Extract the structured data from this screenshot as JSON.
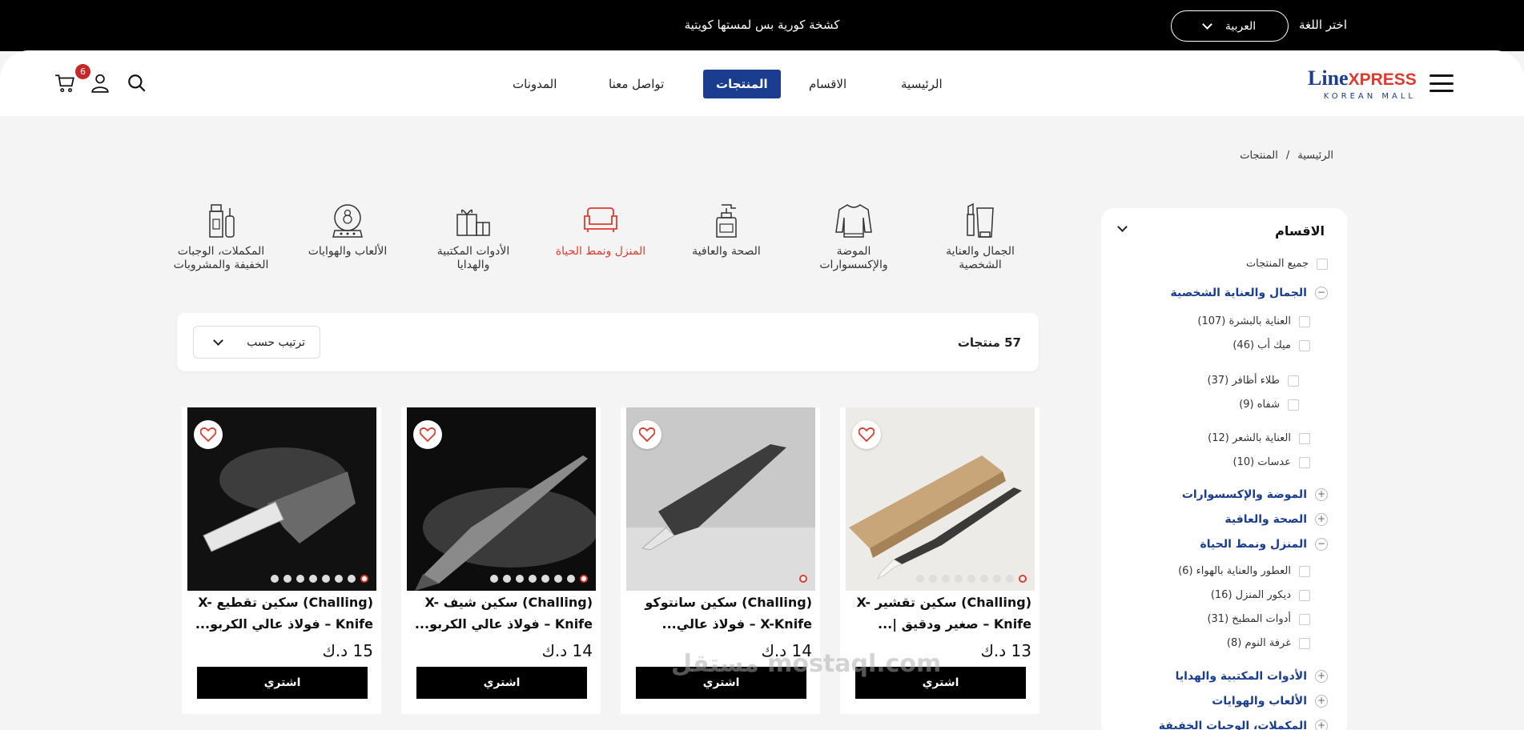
{
  "topbar": {
    "promo": "كشخة كورية بس لمستها كويتية",
    "language_label": "اختر اللغة",
    "language_selected": "العربية"
  },
  "header": {
    "logo_line1": "Line",
    "logo_line1_b": "XPRESS",
    "logo_line2": "KOREAN MALL",
    "nav": [
      "الرئيسية",
      "الاقسام",
      "المنتجات",
      "تواصل معنا",
      "المدونات"
    ],
    "active_nav": "المنتجات",
    "cart_count": "6"
  },
  "breadcrumb": {
    "home": "الرئيسية",
    "sep": "/",
    "current": "المنتجات"
  },
  "sidebar": {
    "title": "الاقسام",
    "all_products": "جميع المنتجات",
    "cat_beauty": "الجمال والعناية الشخصية",
    "sub_skin": "العناية بالبشرة (107)",
    "sub_makeup": "ميك أب (46)",
    "sub_nails": "طلاء أظافر (37)",
    "sub_lips": "شفاه (9)",
    "sub_hair": "العناية بالشعر (12)",
    "sub_lenses": "عدسات (10)",
    "cat_fashion": "الموضة والإكسسوارات",
    "cat_health": "الصحة والعافية",
    "cat_home": "المنزل ونمط الحياة",
    "sub_perfume": "العطور والعناية بالهواء (6)",
    "sub_decor": "ديكور المنزل (16)",
    "sub_kitchen": "أدوات المطبخ (31)",
    "sub_bedroom": "غرفة النوم (8)",
    "cat_office": "الأدوات المكتبية والهدايا",
    "cat_toys": "الألعاب والهوايات",
    "cat_supplements": "المكملات، الوجبات الخفيفة"
  },
  "categories": {
    "c1": "الجمال والعناية الشخصية",
    "c2": "الموضة والإكسسوارات",
    "c3": "الصحة والعافية",
    "c4": "المنزل ونمط الحياة",
    "c5": "الأدوات المكتبية والهدايا",
    "c6": "الألعاب والهوايات",
    "c7": "المكملات، الوجبات الخفيفة والمشروبات"
  },
  "toolbar": {
    "count": "57 منتجات",
    "sort_label": "ترتيب حسب"
  },
  "products": [
    {
      "title": "(Challing) سكين تقشير X-Knife – صغير ودقيق |...",
      "price": "13 د.ك",
      "buy": "اشتري"
    },
    {
      "title": "(Challing) سكين سانتوكو X-Knife – فولاذ عالي...",
      "price": "14 د.ك",
      "buy": "اشتري"
    },
    {
      "title": "(Challing) سكين شيف X-Knife – فولاذ عالي الكربو...",
      "price": "14 د.ك",
      "buy": "اشتري"
    },
    {
      "title": "(Challing) سكين تقطيع X-Knife – فولاذ عالي الكربو...",
      "price": "15 د.ك",
      "buy": "اشتري"
    }
  ],
  "watermark": "مستقل mostaql.com",
  "colors": {
    "brand": "#1a3d8f",
    "accent": "#e03a2f"
  }
}
